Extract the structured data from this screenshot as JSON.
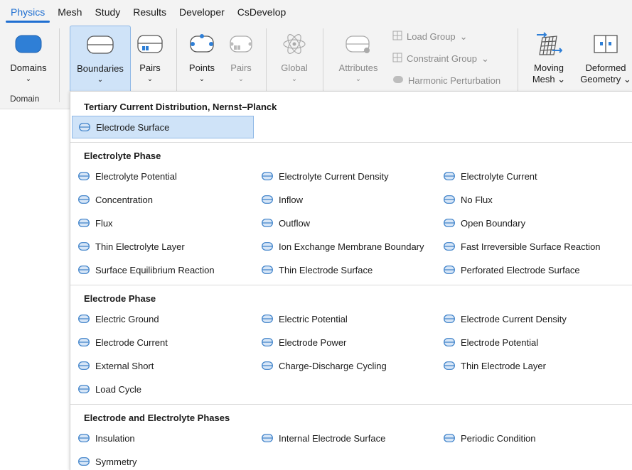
{
  "menu": {
    "tabs": [
      {
        "label": "Physics",
        "active": true
      },
      {
        "label": "Mesh"
      },
      {
        "label": "Study"
      },
      {
        "label": "Results"
      },
      {
        "label": "Developer"
      },
      {
        "label": "CsDevelop"
      }
    ]
  },
  "ribbon": {
    "domains": {
      "label": "Domains"
    },
    "boundaries": {
      "label": "Boundaries"
    },
    "pairs1": {
      "label": "Pairs"
    },
    "points": {
      "label": "Points"
    },
    "pairs2": {
      "label": "Pairs"
    },
    "global": {
      "label": "Global"
    },
    "attributes": {
      "label": "Attributes"
    },
    "load_group": "Load Group",
    "constraint_group": "Constraint Group",
    "harmonic_perturbation": "Harmonic Perturbation",
    "moving_mesh": {
      "line1": "Moving",
      "line2": "Mesh"
    },
    "deformed_geometry": {
      "line1": "Deformed",
      "line2": "Geometry"
    },
    "group_domain": "Domain",
    "chevron": "⌄"
  },
  "dropdown": {
    "sections": [
      {
        "title": "Tertiary Current Distribution, Nernst–Planck",
        "items": [
          "Electrode Surface"
        ],
        "highlighted": 0
      },
      {
        "title": "Electrolyte Phase",
        "items": [
          "Electrolyte Potential",
          "Electrolyte Current Density",
          "Electrolyte Current",
          "Concentration",
          "Inflow",
          "No Flux",
          "Flux",
          "Outflow",
          "Open Boundary",
          "Thin Electrolyte Layer",
          "Ion Exchange Membrane Boundary",
          "Fast Irreversible Surface Reaction",
          "Surface Equilibrium Reaction",
          "Thin Electrode Surface",
          "Perforated Electrode Surface"
        ]
      },
      {
        "title": "Electrode Phase",
        "items": [
          "Electric Ground",
          "Electric Potential",
          "Electrode Current Density",
          "Electrode Current",
          "Electrode Power",
          "Electrode Potential",
          "External Short",
          "Charge-Discharge Cycling",
          "Thin Electrode Layer",
          "Load Cycle"
        ]
      },
      {
        "title": "Electrode and Electrolyte Phases",
        "items": [
          "Insulation",
          "Internal Electrode Surface",
          "Periodic Condition",
          "Symmetry"
        ]
      }
    ]
  },
  "colors": {
    "accent": "#1f6fd1",
    "highlight": "#cfe3f8",
    "boundary_icon_fill": "#d7e6f7",
    "boundary_icon_stroke": "#3a7fc8"
  }
}
